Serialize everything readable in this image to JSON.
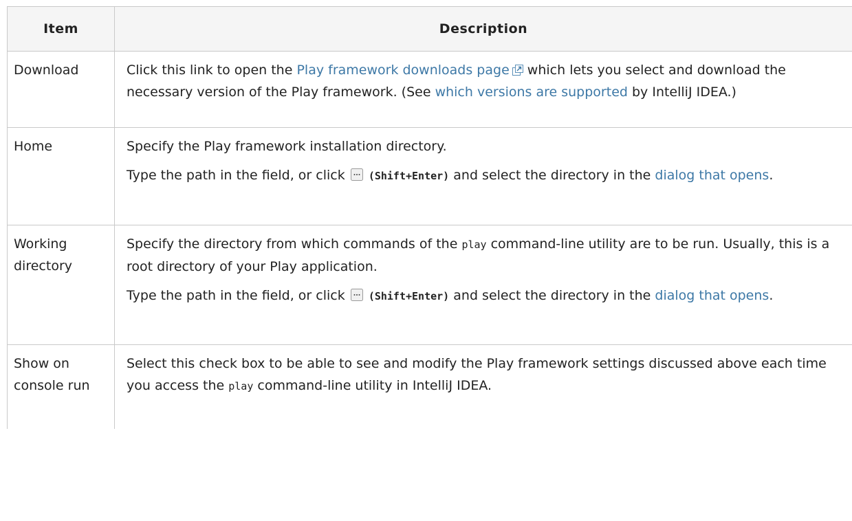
{
  "headers": {
    "item": "Item",
    "description": "Description"
  },
  "rows": {
    "download": {
      "item": "Download",
      "pre": "Click this link to open the ",
      "link": "Play framework downloads page",
      "mid": " which lets you select and download the necessary version of the Play framework. (See ",
      "link2": "which versions are supported",
      "post": " by IntelliJ IDEA.)"
    },
    "home": {
      "item": "Home",
      "p1": "Specify the Play framework installation directory.",
      "p2_pre": "Type the path in the field, or click ",
      "shortcut": "(Shift+Enter)",
      "p2_mid": " and select the directory in the ",
      "link": "dialog that opens",
      "p2_post": "."
    },
    "workdir": {
      "item": "Working directory",
      "p1_pre": "Specify the directory from which commands of the ",
      "code": "play",
      "p1_post": " command-line utility are to be run. Usually, this is a root directory of your Play application.",
      "p2_pre": "Type the path in the field, or click ",
      "shortcut": "(Shift+Enter)",
      "p2_mid": " and select the directory in the ",
      "link": "dialog that opens",
      "p2_post": "."
    },
    "show": {
      "item": "Show on console run",
      "pre": "Select this check box to be able to see and modify the Play framework settings discussed above each time you access the ",
      "code": "play",
      "post": " command-line utility in IntelliJ IDEA."
    }
  },
  "icons": {
    "external_link": "external-link-icon",
    "browse": "browse-ellipsis-icon"
  },
  "colors": {
    "link": "#3d78a6",
    "border": "#c9c9c9",
    "header_bg": "#f5f5f5"
  }
}
